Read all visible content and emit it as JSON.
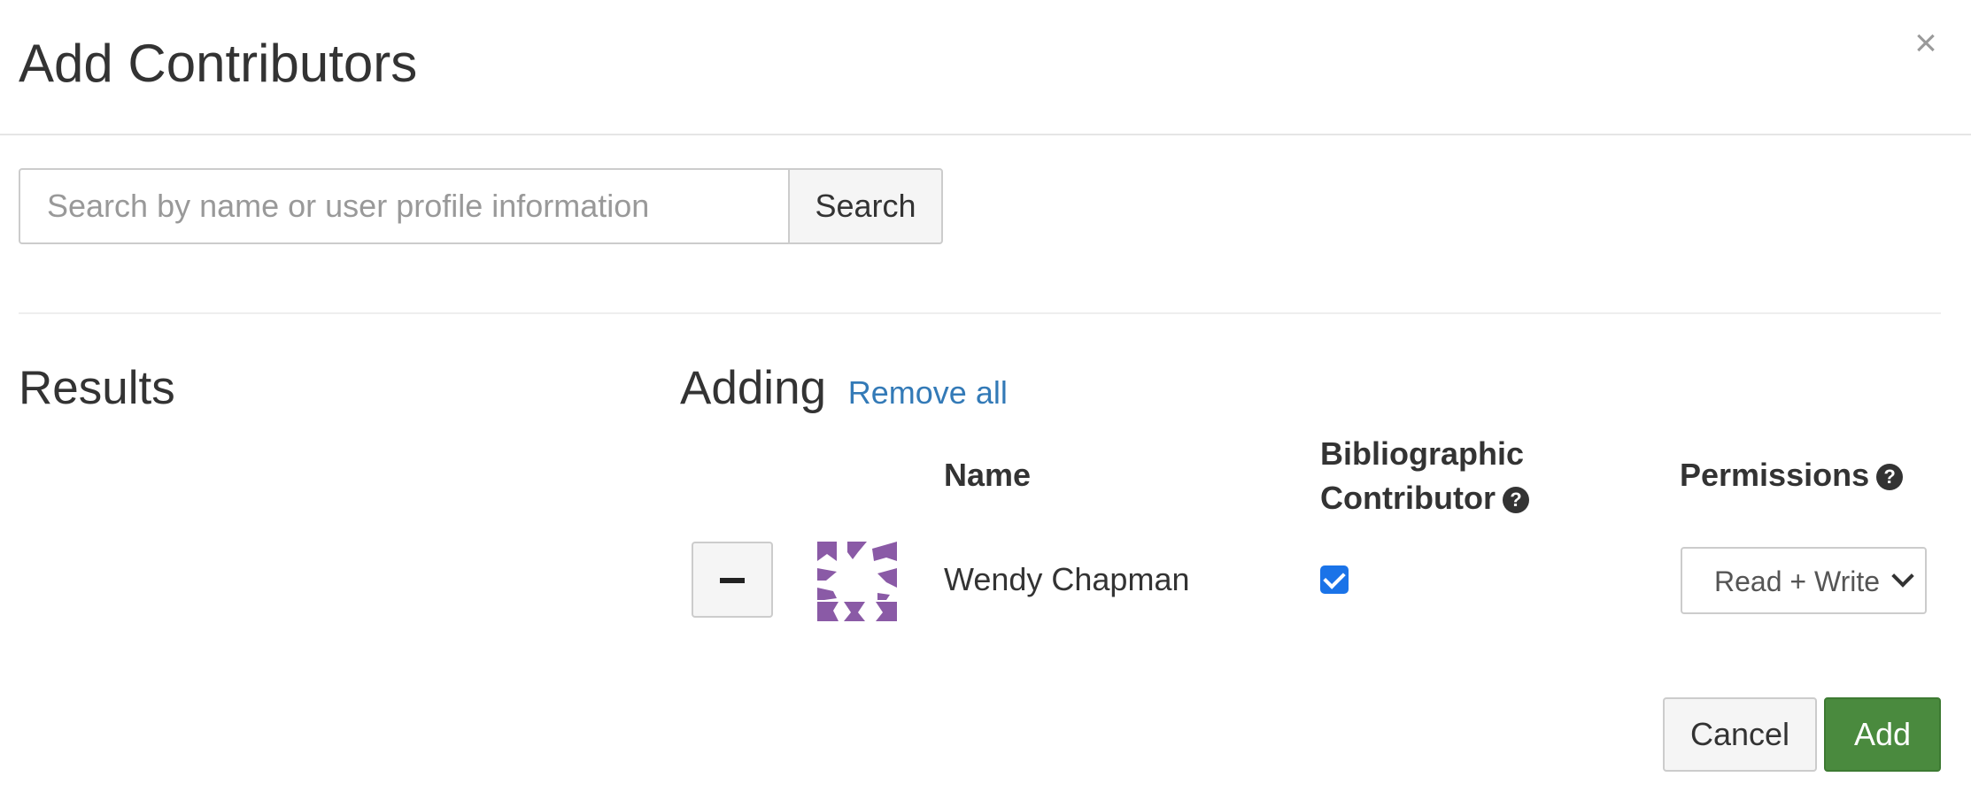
{
  "modal": {
    "title": "Add Contributors",
    "close_glyph": "×"
  },
  "search": {
    "placeholder": "Search by name or user profile information",
    "button_label": "Search"
  },
  "results": {
    "heading": "Results"
  },
  "adding": {
    "heading": "Adding",
    "remove_all_label": "Remove all",
    "columns": {
      "name": "Name",
      "bibliographic": "Bibliographic Contributor",
      "permissions": "Permissions"
    },
    "contributors": [
      {
        "name": "Wendy Chapman",
        "bibliographic": true,
        "permission": "Read + Write"
      }
    ]
  },
  "footer": {
    "cancel_label": "Cancel",
    "add_label": "Add"
  },
  "colors": {
    "link": "#337ab7",
    "primary_green": "#4a8a3e",
    "avatar_purple": "#8a5aa6",
    "checkbox_blue": "#1a73e8"
  },
  "icons": {
    "close": "close-icon",
    "help": "question-circle-icon",
    "remove": "minus-icon",
    "select": "chevron-down-icon"
  }
}
